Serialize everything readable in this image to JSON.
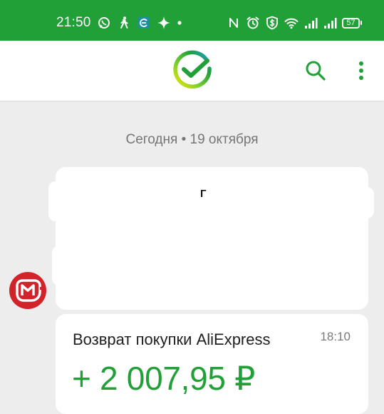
{
  "status_bar": {
    "time": "21:50",
    "battery": "57",
    "left_icons": [
      "whatsapp-icon",
      "walking-icon",
      "app-icon",
      "sparkle-icon",
      "dot-icon"
    ],
    "right_icons": [
      "nfc-icon",
      "alarm-icon",
      "shield-dollar-icon",
      "wifi-icon",
      "signal-icon",
      "signal-icon"
    ]
  },
  "header": {
    "logo": "sber-logo-icon",
    "search_icon": "search-icon",
    "menu_icon": "more-vertical-icon"
  },
  "feed": {
    "date_label": "Сегодня • 19 октября",
    "first_card_mark": "Г",
    "merchant_logo": "magnit-logo-icon",
    "transaction": {
      "title": "Возврат покупки AliExpress",
      "time": "18:10",
      "amount": "+ 2 007,95 ₽"
    }
  },
  "colors": {
    "brand_green": "#21a038",
    "background": "#ededed",
    "card": "#ffffff",
    "muted_text": "#757575",
    "merchant_red": "#d2232a"
  }
}
